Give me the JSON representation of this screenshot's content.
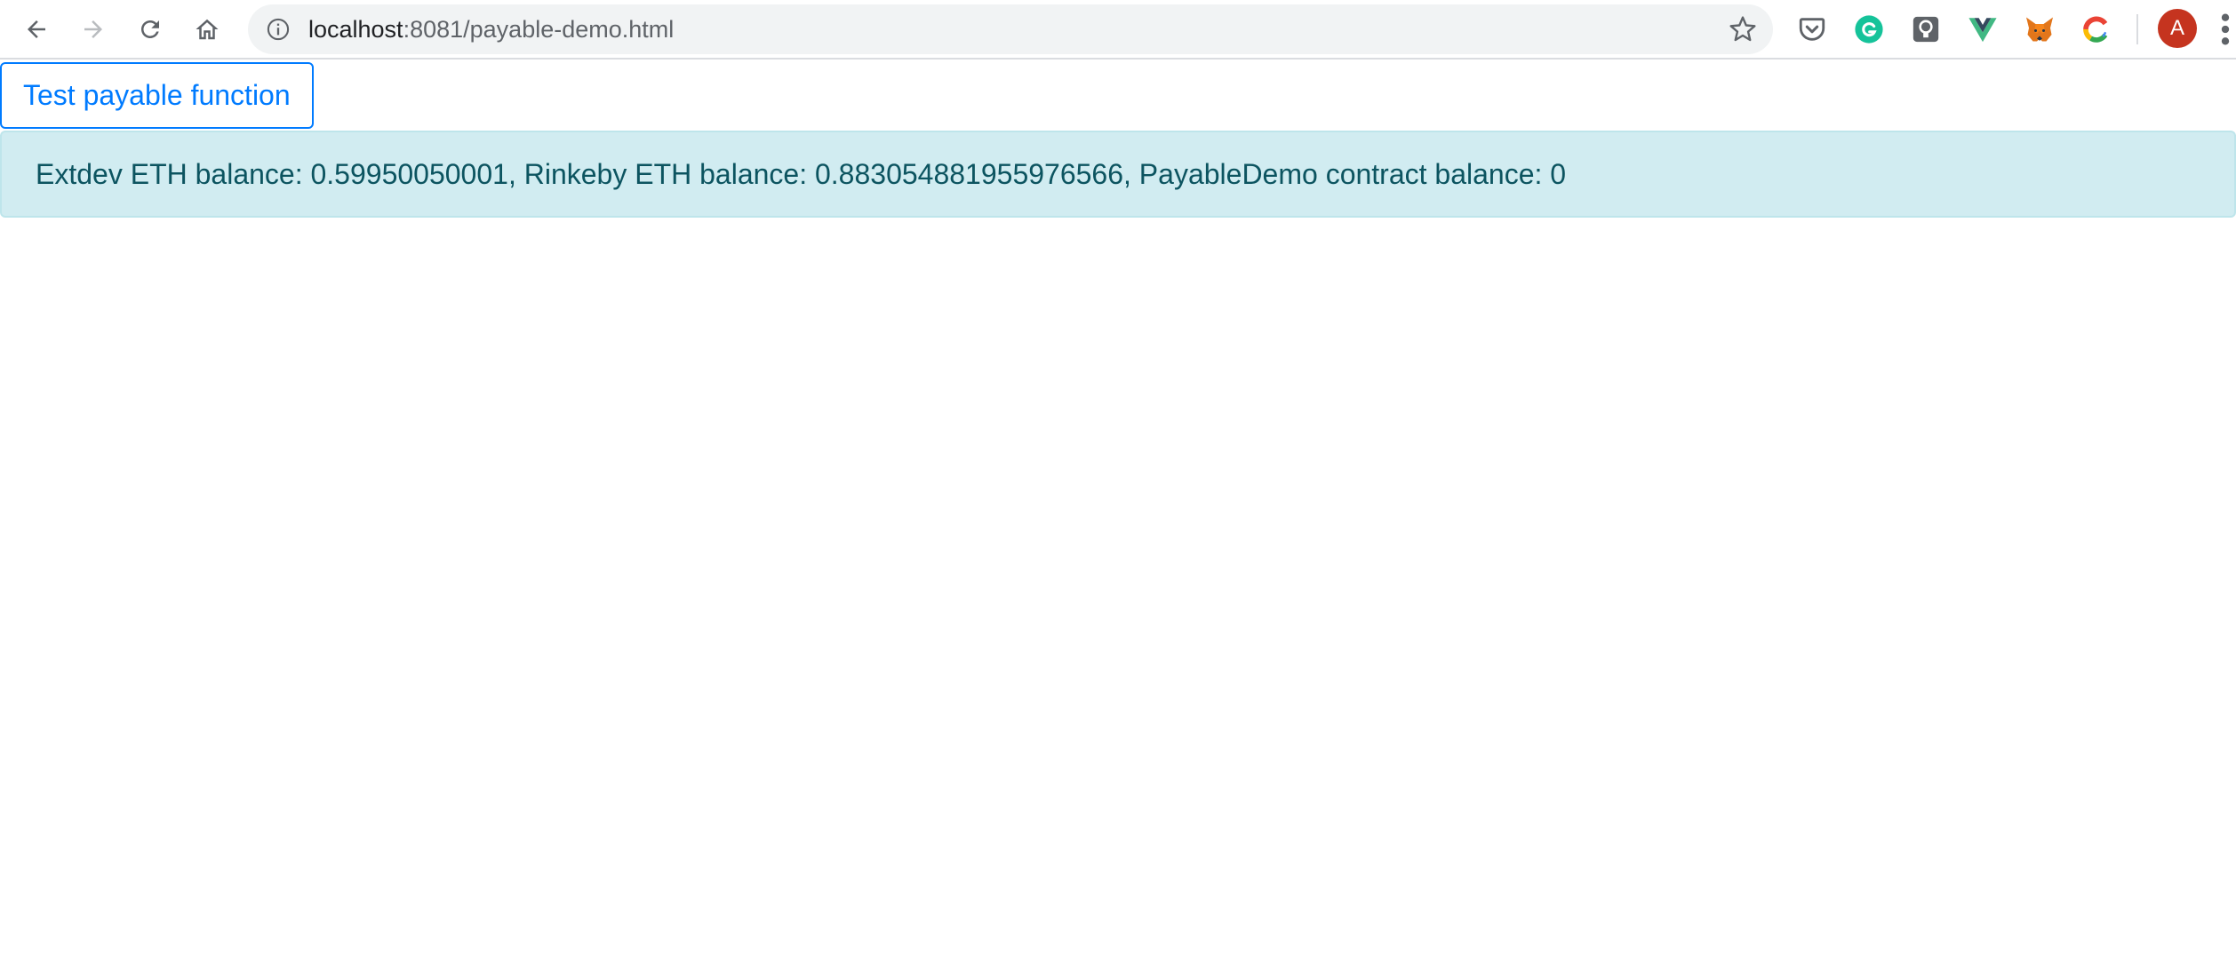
{
  "browser": {
    "url_host": "localhost",
    "url_rest": ":8081/payable-demo.html",
    "icons": {
      "back": "back-arrow-icon",
      "forward": "forward-arrow-icon",
      "reload": "reload-icon",
      "home": "home-icon",
      "info": "info-icon",
      "bookmark": "star-icon",
      "menu": "kebab-menu-icon"
    },
    "extensions": [
      "pocket-icon",
      "grammarly-icon",
      "lightbulb-icon",
      "vue-devtools-icon",
      "metamask-icon",
      "google-c-icon"
    ],
    "avatar_letter": "A",
    "colors": {
      "omnibox": "#f1f3f4",
      "avatar": "#c5341f"
    }
  },
  "page": {
    "test_button_label": "Test payable function",
    "balance_message": "Extdev ETH balance: 0.59950050001, Rinkeby ETH balance: 0.883054881955976566, PayableDemo contract balance: 0",
    "colors": {
      "primary": "#007bff",
      "alert_bg": "#d1ecf1",
      "alert_text": "#0c5460"
    }
  }
}
